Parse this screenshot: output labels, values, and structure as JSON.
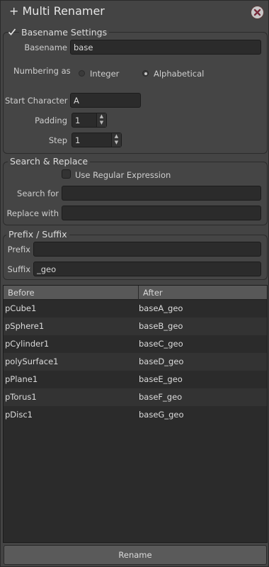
{
  "window": {
    "title": "+ Multi Renamer"
  },
  "basename_settings": {
    "title": "Basename Settings",
    "checked": true,
    "basename_label": "Basename",
    "basename_value": "base",
    "numbering_label": "Numbering as",
    "numbering_options": [
      "Integer",
      "Alphabetical"
    ],
    "numbering_selected": "Alphabetical",
    "start_character_label": "Start Character",
    "start_character_value": "A",
    "padding_label": "Padding",
    "padding_value": "1",
    "step_label": "Step",
    "step_value": "1"
  },
  "search_replace": {
    "title": "Search & Replace",
    "regex_label": "Use Regular Expression",
    "regex_checked": false,
    "search_label": "Search for",
    "search_value": "",
    "replace_label": "Replace with",
    "replace_value": ""
  },
  "prefix_suffix": {
    "title": "Prefix / Suffix",
    "prefix_label": "Prefix",
    "prefix_value": "",
    "suffix_label": "Suffix",
    "suffix_value": "_geo"
  },
  "preview_table": {
    "columns": [
      "Before",
      "After"
    ],
    "rows": [
      [
        "pCube1",
        "baseA_geo"
      ],
      [
        "pSphere1",
        "baseB_geo"
      ],
      [
        "pCylinder1",
        "baseC_geo"
      ],
      [
        "polySurface1",
        "baseD_geo"
      ],
      [
        "pPlane1",
        "baseE_geo"
      ],
      [
        "pTorus1",
        "baseF_geo"
      ],
      [
        "pDisc1",
        "baseG_geo"
      ]
    ]
  },
  "actions": {
    "rename_label": "Rename"
  },
  "icons": {
    "close": "close-icon",
    "checkmark": "checkmark-icon"
  },
  "colors": {
    "panel_bg": "#444444",
    "field_bg": "#2b2b2b",
    "close_bg": "#c7c7c7",
    "close_x": "#7a2a3a"
  }
}
